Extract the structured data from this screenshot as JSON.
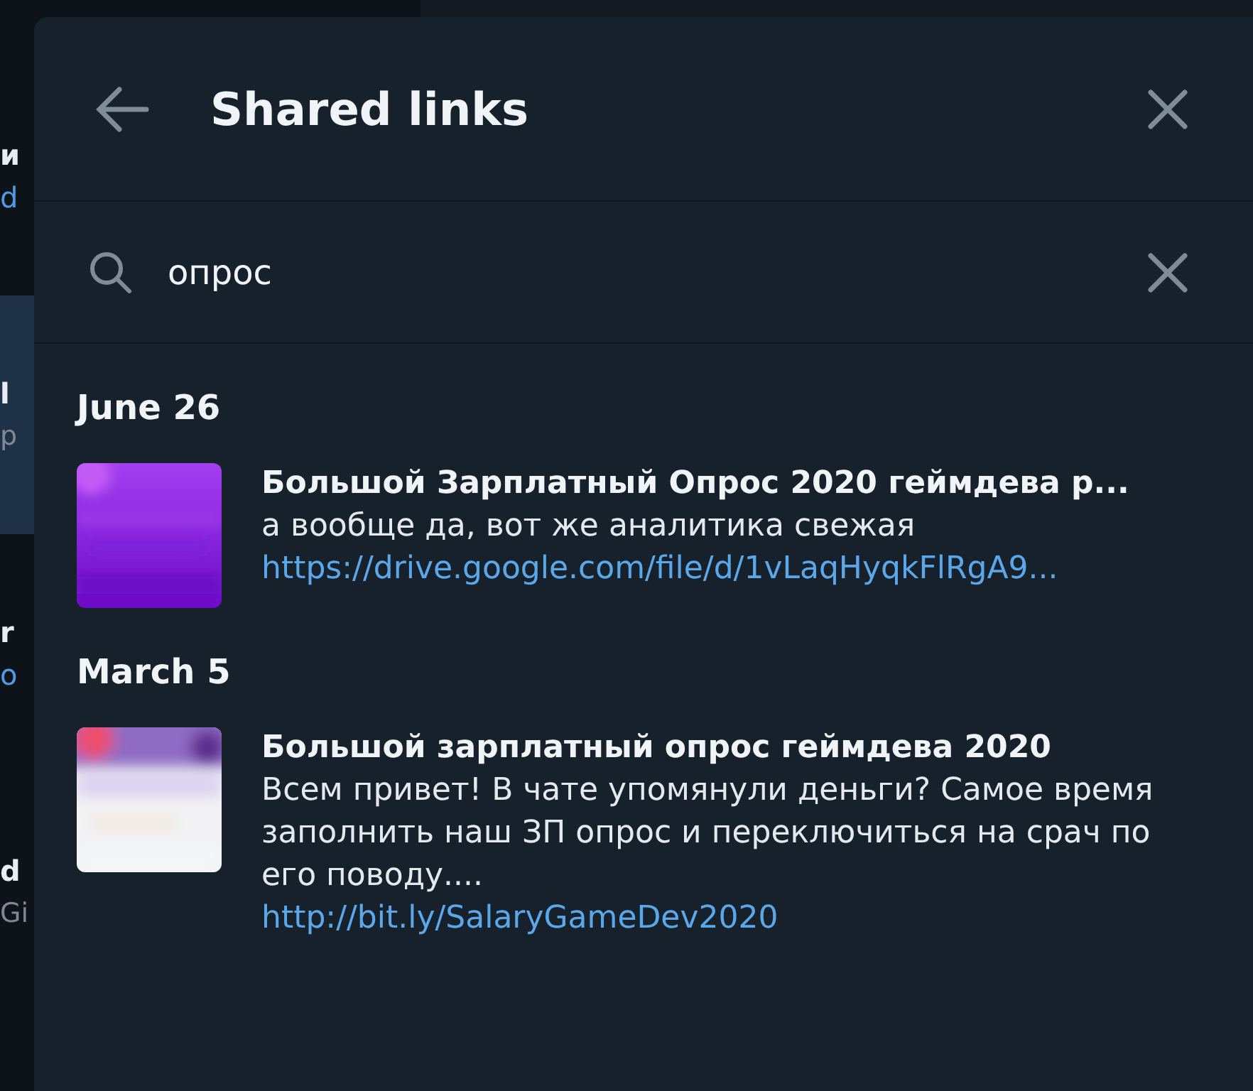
{
  "background": {
    "chat_fragments": [
      {
        "text": "и",
        "kind": "title"
      },
      {
        "text": "d",
        "kind": "link"
      },
      {
        "text": "l",
        "kind": "title",
        "selected": true
      },
      {
        "text": "p",
        "kind": "preview",
        "selected": true
      },
      {
        "text": "r",
        "kind": "title"
      },
      {
        "text": "o",
        "kind": "link"
      },
      {
        "text": "d",
        "kind": "title"
      },
      {
        "text": "Gi",
        "kind": "preview"
      }
    ]
  },
  "panel": {
    "title": "Shared links",
    "search": {
      "value": "опрос"
    },
    "groups": [
      {
        "date": "June 26",
        "items": [
          {
            "title": "Большой Зарплатный Опрос 2020 геймдева р...",
            "description": "а вообще да, вот же аналитика свежая",
            "url": "https://drive.google.com/file/d/1vLaqHyqkFlRgA9..."
          }
        ]
      },
      {
        "date": "March 5",
        "items": [
          {
            "title": "Большой зарплатный опрос геймдева 2020",
            "description": "Всем привет! В чате упомянули деньги? Самое время заполнить наш ЗП опрос и переключиться на срач по его поводу....",
            "url": "http://bit.ly/SalaryGameDev2020"
          }
        ]
      }
    ]
  }
}
